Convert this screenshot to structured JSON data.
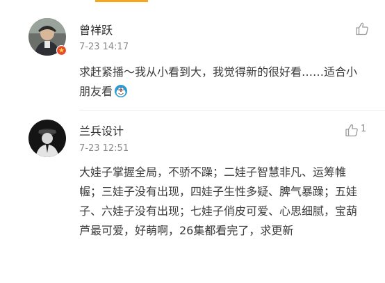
{
  "colors": {
    "accent": "#f5a623",
    "text": "#3a3a3a",
    "meta": "#8a8a8a",
    "divider": "#ededed"
  },
  "comments": [
    {
      "username": "曾祥跃",
      "timestamp": "7-23 14:17",
      "text": "求赶紧播～我从小看到大，我觉得新的很好看……适合小朋友看",
      "emoji": "doraemon-icon",
      "like_count": "",
      "avatar": "user-avatar-photo"
    },
    {
      "username": "兰兵设计",
      "timestamp": "7-23 12:51",
      "text": "大娃子掌握全局，不骄不躁；二娃子智慧非凡、运筹帷幄；三娃子没有出现，四娃子生性多疑、脾气暴躁；五娃子、六娃子没有出现；七娃子俏皮可爱、心思细腻，宝葫芦最可爱，好萌啊，26集都看完了，求更新",
      "emoji": "",
      "like_count": "1",
      "avatar": "user-avatar-dark"
    }
  ]
}
